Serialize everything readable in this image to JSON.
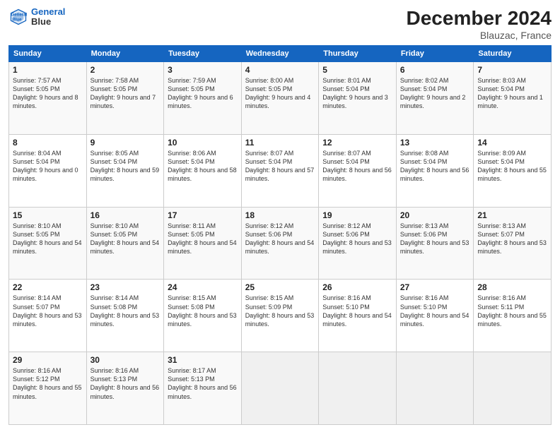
{
  "header": {
    "logo_line1": "General",
    "logo_line2": "Blue",
    "title": "December 2024",
    "subtitle": "Blauzac, France"
  },
  "columns": [
    "Sunday",
    "Monday",
    "Tuesday",
    "Wednesday",
    "Thursday",
    "Friday",
    "Saturday"
  ],
  "weeks": [
    [
      {
        "day": "1",
        "detail": "Sunrise: 7:57 AM\nSunset: 5:05 PM\nDaylight: 9 hours and 8 minutes."
      },
      {
        "day": "2",
        "detail": "Sunrise: 7:58 AM\nSunset: 5:05 PM\nDaylight: 9 hours and 7 minutes."
      },
      {
        "day": "3",
        "detail": "Sunrise: 7:59 AM\nSunset: 5:05 PM\nDaylight: 9 hours and 6 minutes."
      },
      {
        "day": "4",
        "detail": "Sunrise: 8:00 AM\nSunset: 5:05 PM\nDaylight: 9 hours and 4 minutes."
      },
      {
        "day": "5",
        "detail": "Sunrise: 8:01 AM\nSunset: 5:04 PM\nDaylight: 9 hours and 3 minutes."
      },
      {
        "day": "6",
        "detail": "Sunrise: 8:02 AM\nSunset: 5:04 PM\nDaylight: 9 hours and 2 minutes."
      },
      {
        "day": "7",
        "detail": "Sunrise: 8:03 AM\nSunset: 5:04 PM\nDaylight: 9 hours and 1 minute."
      }
    ],
    [
      {
        "day": "8",
        "detail": "Sunrise: 8:04 AM\nSunset: 5:04 PM\nDaylight: 9 hours and 0 minutes."
      },
      {
        "day": "9",
        "detail": "Sunrise: 8:05 AM\nSunset: 5:04 PM\nDaylight: 8 hours and 59 minutes."
      },
      {
        "day": "10",
        "detail": "Sunrise: 8:06 AM\nSunset: 5:04 PM\nDaylight: 8 hours and 58 minutes."
      },
      {
        "day": "11",
        "detail": "Sunrise: 8:07 AM\nSunset: 5:04 PM\nDaylight: 8 hours and 57 minutes."
      },
      {
        "day": "12",
        "detail": "Sunrise: 8:07 AM\nSunset: 5:04 PM\nDaylight: 8 hours and 56 minutes."
      },
      {
        "day": "13",
        "detail": "Sunrise: 8:08 AM\nSunset: 5:04 PM\nDaylight: 8 hours and 56 minutes."
      },
      {
        "day": "14",
        "detail": "Sunrise: 8:09 AM\nSunset: 5:04 PM\nDaylight: 8 hours and 55 minutes."
      }
    ],
    [
      {
        "day": "15",
        "detail": "Sunrise: 8:10 AM\nSunset: 5:05 PM\nDaylight: 8 hours and 54 minutes."
      },
      {
        "day": "16",
        "detail": "Sunrise: 8:10 AM\nSunset: 5:05 PM\nDaylight: 8 hours and 54 minutes."
      },
      {
        "day": "17",
        "detail": "Sunrise: 8:11 AM\nSunset: 5:05 PM\nDaylight: 8 hours and 54 minutes."
      },
      {
        "day": "18",
        "detail": "Sunrise: 8:12 AM\nSunset: 5:06 PM\nDaylight: 8 hours and 54 minutes."
      },
      {
        "day": "19",
        "detail": "Sunrise: 8:12 AM\nSunset: 5:06 PM\nDaylight: 8 hours and 53 minutes."
      },
      {
        "day": "20",
        "detail": "Sunrise: 8:13 AM\nSunset: 5:06 PM\nDaylight: 8 hours and 53 minutes."
      },
      {
        "day": "21",
        "detail": "Sunrise: 8:13 AM\nSunset: 5:07 PM\nDaylight: 8 hours and 53 minutes."
      }
    ],
    [
      {
        "day": "22",
        "detail": "Sunrise: 8:14 AM\nSunset: 5:07 PM\nDaylight: 8 hours and 53 minutes."
      },
      {
        "day": "23",
        "detail": "Sunrise: 8:14 AM\nSunset: 5:08 PM\nDaylight: 8 hours and 53 minutes."
      },
      {
        "day": "24",
        "detail": "Sunrise: 8:15 AM\nSunset: 5:08 PM\nDaylight: 8 hours and 53 minutes."
      },
      {
        "day": "25",
        "detail": "Sunrise: 8:15 AM\nSunset: 5:09 PM\nDaylight: 8 hours and 53 minutes."
      },
      {
        "day": "26",
        "detail": "Sunrise: 8:16 AM\nSunset: 5:10 PM\nDaylight: 8 hours and 54 minutes."
      },
      {
        "day": "27",
        "detail": "Sunrise: 8:16 AM\nSunset: 5:10 PM\nDaylight: 8 hours and 54 minutes."
      },
      {
        "day": "28",
        "detail": "Sunrise: 8:16 AM\nSunset: 5:11 PM\nDaylight: 8 hours and 55 minutes."
      }
    ],
    [
      {
        "day": "29",
        "detail": "Sunrise: 8:16 AM\nSunset: 5:12 PM\nDaylight: 8 hours and 55 minutes."
      },
      {
        "day": "30",
        "detail": "Sunrise: 8:16 AM\nSunset: 5:13 PM\nDaylight: 8 hours and 56 minutes."
      },
      {
        "day": "31",
        "detail": "Sunrise: 8:17 AM\nSunset: 5:13 PM\nDaylight: 8 hours and 56 minutes."
      },
      {
        "day": "",
        "detail": ""
      },
      {
        "day": "",
        "detail": ""
      },
      {
        "day": "",
        "detail": ""
      },
      {
        "day": "",
        "detail": ""
      }
    ]
  ]
}
